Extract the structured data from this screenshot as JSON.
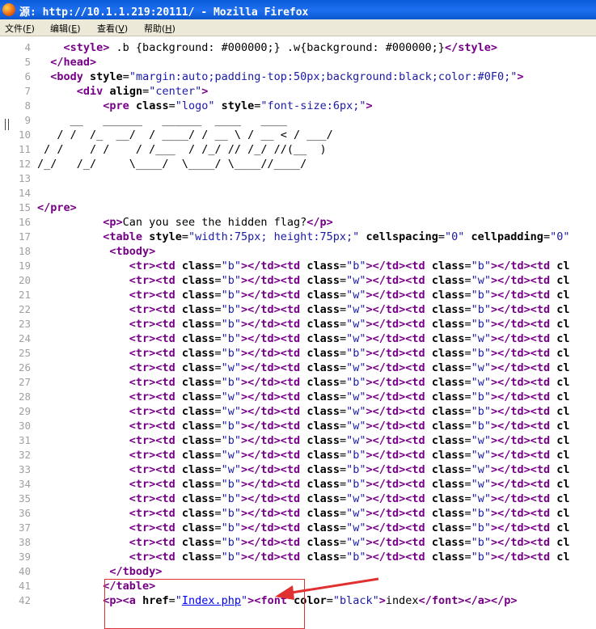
{
  "window": {
    "title": "源: http://10.1.1.219:20111/ - Mozilla Firefox"
  },
  "menu": {
    "items": [
      {
        "label": "文件(",
        "key": "F",
        "suffix": ")"
      },
      {
        "label": "编辑(",
        "key": "E",
        "suffix": ")"
      },
      {
        "label": "查看(",
        "key": "V",
        "suffix": ")"
      },
      {
        "label": "帮助(",
        "key": "H",
        "suffix": ")"
      }
    ]
  },
  "source": {
    "line_numbers": [
      "4",
      "5",
      "6",
      "7",
      "8",
      "9",
      "10",
      "11",
      "12",
      "13",
      "14",
      "15",
      "16",
      "17",
      "18",
      "19",
      "20",
      "21",
      "22",
      "23",
      "24",
      "25",
      "26",
      "27",
      "28",
      "29",
      "30",
      "31",
      "32",
      "33",
      "34",
      "35",
      "36",
      "37",
      "38",
      "39",
      "40",
      "41",
      "42"
    ],
    "head_lines": [
      "    <style> .b {background: #000000;} .w{background: #000000;}</style>",
      "  </head>",
      "  <body style=\"margin:auto;padding-top:50px;background:black;color:#0F0;\">",
      "      <div align=\"center\">",
      "          <pre class=\"logo\" style=\"font-size:6px;\">"
    ],
    "ascii_art": [
      "  __   ______   ______  ____   ____",
      " / /  /_  __/  / ____/ / __ \\ / __ < / ___/",
      "/ /    / /    / /___  / /_/ // /_/ //(__  )",
      "/_/   /_/     \\____/  \\____/ \\____//____/"
    ],
    "pre_close": "</pre>",
    "p_text": "Can you see the hidden flag?",
    "table_open": "<table style=\"width:75px; height:75px;\" cellspacing=\"0\" cellpadding=\"0\"",
    "tbody_open": "<tbody>",
    "rows": [
      [
        "b",
        "b",
        "b"
      ],
      [
        "b",
        "w",
        "w"
      ],
      [
        "b",
        "w",
        "b"
      ],
      [
        "b",
        "w",
        "b"
      ],
      [
        "b",
        "w",
        "b"
      ],
      [
        "b",
        "w",
        "w"
      ],
      [
        "b",
        "b",
        "b"
      ],
      [
        "w",
        "w",
        "w"
      ],
      [
        "b",
        "b",
        "w"
      ],
      [
        "w",
        "w",
        "b"
      ],
      [
        "w",
        "w",
        "b"
      ],
      [
        "b",
        "w",
        "b"
      ],
      [
        "b",
        "w",
        "w"
      ],
      [
        "w",
        "b",
        "w"
      ],
      [
        "w",
        "b",
        "w"
      ],
      [
        "b",
        "b",
        "w"
      ],
      [
        "b",
        "w",
        "w"
      ],
      [
        "b",
        "w",
        "b"
      ],
      [
        "b",
        "w",
        "b"
      ],
      [
        "b",
        "w",
        "b"
      ],
      [
        "b",
        "b",
        "b"
      ]
    ],
    "tbody_close": "</tbody>",
    "table_close": "</table>",
    "link_href": "Index.php",
    "link_font_color": "black",
    "link_text": "index"
  },
  "annotation": {
    "box_color": "#e03030",
    "arrow_color": "#e03030"
  }
}
